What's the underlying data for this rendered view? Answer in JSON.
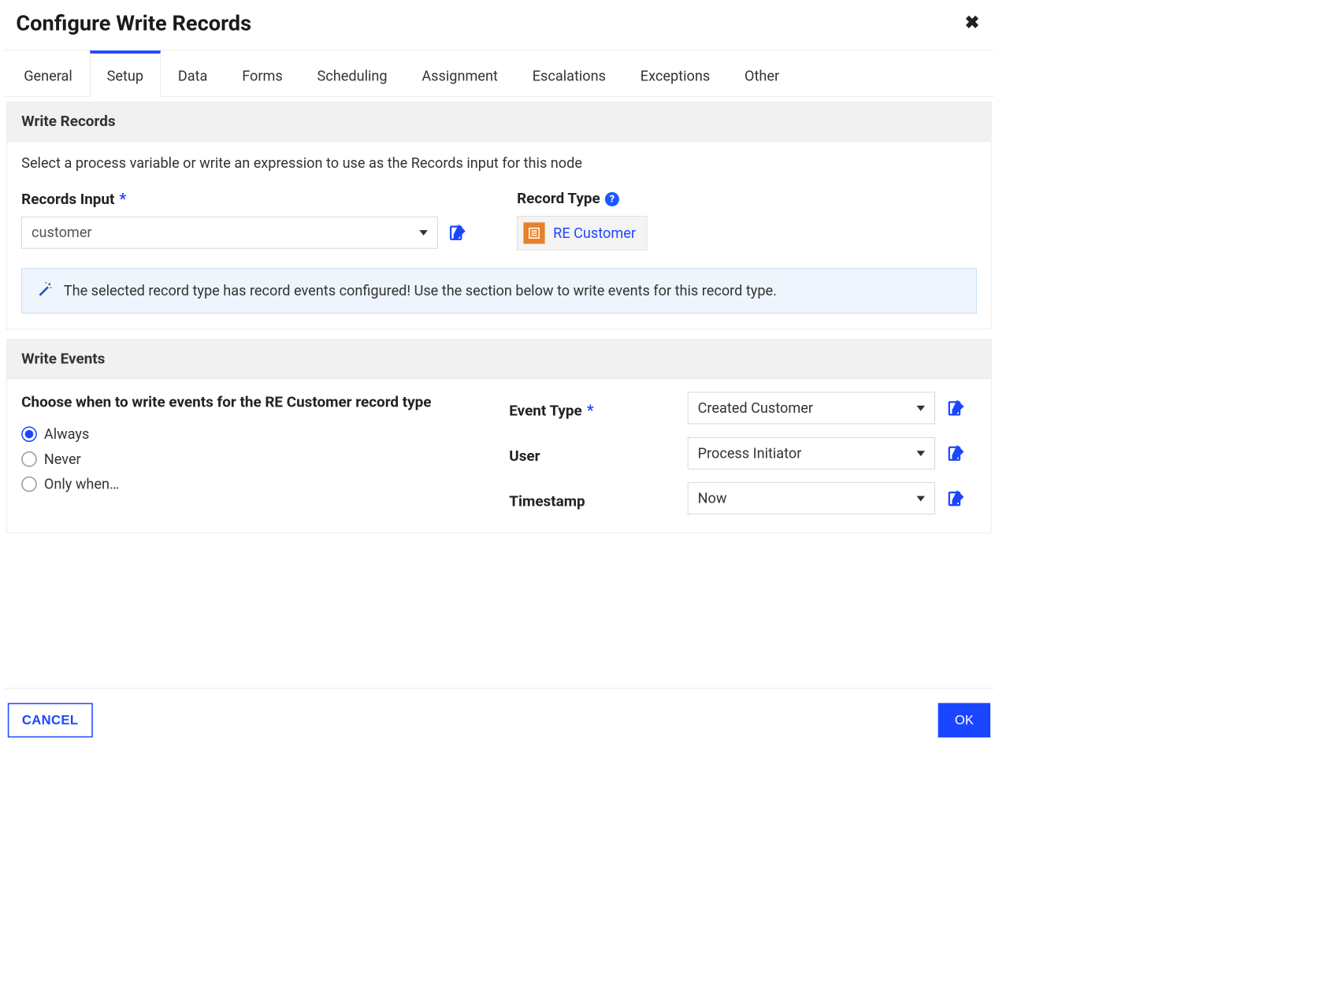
{
  "header": {
    "title": "Configure Write Records"
  },
  "tabs": [
    {
      "label": "General",
      "active": false
    },
    {
      "label": "Setup",
      "active": true
    },
    {
      "label": "Data",
      "active": false
    },
    {
      "label": "Forms",
      "active": false
    },
    {
      "label": "Scheduling",
      "active": false
    },
    {
      "label": "Assignment",
      "active": false
    },
    {
      "label": "Escalations",
      "active": false
    },
    {
      "label": "Exceptions",
      "active": false
    },
    {
      "label": "Other",
      "active": false
    }
  ],
  "write_records": {
    "section_title": "Write Records",
    "description": "Select a process variable or write an expression to use as the Records input for this node",
    "records_input_label": "Records Input",
    "records_input_value": "customer",
    "record_type_label": "Record Type",
    "record_type_value": "RE Customer",
    "info_message": "The selected record type has record events configured! Use the section below to write events for this record type."
  },
  "write_events": {
    "section_title": "Write Events",
    "heading": "Choose when to write events for the RE Customer record type",
    "radio_options": [
      {
        "label": "Always",
        "checked": true
      },
      {
        "label": "Never",
        "checked": false
      },
      {
        "label": "Only when…",
        "checked": false
      }
    ],
    "event_type_label": "Event Type",
    "event_type_value": "Created Customer",
    "user_label": "User",
    "user_value": "Process Initiator",
    "timestamp_label": "Timestamp",
    "timestamp_value": "Now"
  },
  "footer": {
    "cancel_label": "CANCEL",
    "ok_label": "OK"
  },
  "colors": {
    "accent": "#1b46ff",
    "record_icon_bg": "#e6812b",
    "info_bg": "#eef5fc"
  }
}
